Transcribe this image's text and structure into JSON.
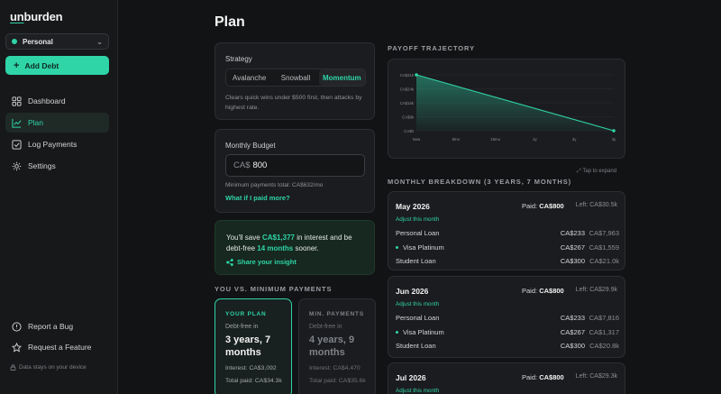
{
  "app": {
    "logo_a": "un",
    "logo_b": "burden"
  },
  "sidebar": {
    "account": "Personal",
    "add_debt": "Add Debt",
    "items": [
      {
        "label": "Dashboard",
        "icon": "grid-icon",
        "active": false
      },
      {
        "label": "Plan",
        "icon": "chart-line-icon",
        "active": true
      },
      {
        "label": "Log Payments",
        "icon": "check-square-icon",
        "active": false
      },
      {
        "label": "Settings",
        "icon": "gear-icon",
        "active": false
      }
    ],
    "bottom": [
      {
        "label": "Report a Bug",
        "icon": "alert-circle-icon"
      },
      {
        "label": "Request a Feature",
        "icon": "star-icon"
      }
    ],
    "note": "Data stays on your device"
  },
  "page": {
    "title": "Plan"
  },
  "strategy": {
    "label": "Strategy",
    "options": [
      "Avalanche",
      "Snowball",
      "Momentum"
    ],
    "selected": "Momentum",
    "description": "Clears quick wins under $500 first, then attacks by highest rate."
  },
  "budget": {
    "label": "Monthly Budget",
    "currency": "CA$",
    "value": "800",
    "min_note": "Minimum payments total: CA$632/mo",
    "what_if": "What if I paid more?"
  },
  "savings": {
    "pre": "You'll save ",
    "amount": "CA$1,377",
    "mid": " in interest and be debt-free ",
    "months": "14 months",
    "post": " sooner.",
    "share": "Share your insight"
  },
  "comparison": {
    "heading": "YOU VS. MINIMUM PAYMENTS",
    "plan": {
      "tag": "YOUR PLAN",
      "debt_free": "Debt-free in",
      "time": "3 years, 7 months",
      "interest": "Interest: CA$3,092",
      "total": "Total paid: CA$34.3k"
    },
    "minimum": {
      "tag": "MIN. PAYMENTS",
      "debt_free": "Debt-free in",
      "time": "4 years, 9 months",
      "interest": "Interest: CA$4,470",
      "total": "Total paid: CA$35.6k"
    }
  },
  "trajectory": {
    "heading": "PAYOFF TRAJECTORY",
    "expand": "Tap to expand"
  },
  "chart_data": {
    "type": "line",
    "title": "",
    "y_ticks": [
      "CA$31k",
      "CA$24k",
      "CA$16k",
      "CA$8k",
      "CA$0"
    ],
    "x_ticks": [
      "Now",
      "8mo",
      "16mo",
      "2y",
      "3y",
      "3y"
    ],
    "x": [
      0,
      43
    ],
    "y": [
      31000,
      0
    ],
    "ylim": [
      0,
      31000
    ],
    "grid": true,
    "accent": "#2fd4a7"
  },
  "breakdown": {
    "heading": "MONTHLY BREAKDOWN (3 YEARS, 7 MONTHS)",
    "paid_label": "Paid:",
    "left_label": "Left:",
    "adjust": "Adjust this month",
    "months": [
      {
        "name": "May 2026",
        "paid": "CA$800",
        "left": "CA$30.5k",
        "rows": [
          {
            "name": "Personal Loan",
            "payment": "CA$233",
            "balance": "CA$7,963",
            "focus": false
          },
          {
            "name": "Visa Platinum",
            "payment": "CA$267",
            "balance": "CA$1,559",
            "focus": true
          },
          {
            "name": "Student Loan",
            "payment": "CA$300",
            "balance": "CA$21.0k",
            "focus": false
          }
        ]
      },
      {
        "name": "Jun 2026",
        "paid": "CA$800",
        "left": "CA$29.9k",
        "rows": [
          {
            "name": "Personal Loan",
            "payment": "CA$233",
            "balance": "CA$7,816",
            "focus": false
          },
          {
            "name": "Visa Platinum",
            "payment": "CA$267",
            "balance": "CA$1,317",
            "focus": true
          },
          {
            "name": "Student Loan",
            "payment": "CA$300",
            "balance": "CA$20.8k",
            "focus": false
          }
        ]
      },
      {
        "name": "Jul 2026",
        "paid": "CA$800",
        "left": "CA$29.3k",
        "rows": []
      }
    ]
  }
}
